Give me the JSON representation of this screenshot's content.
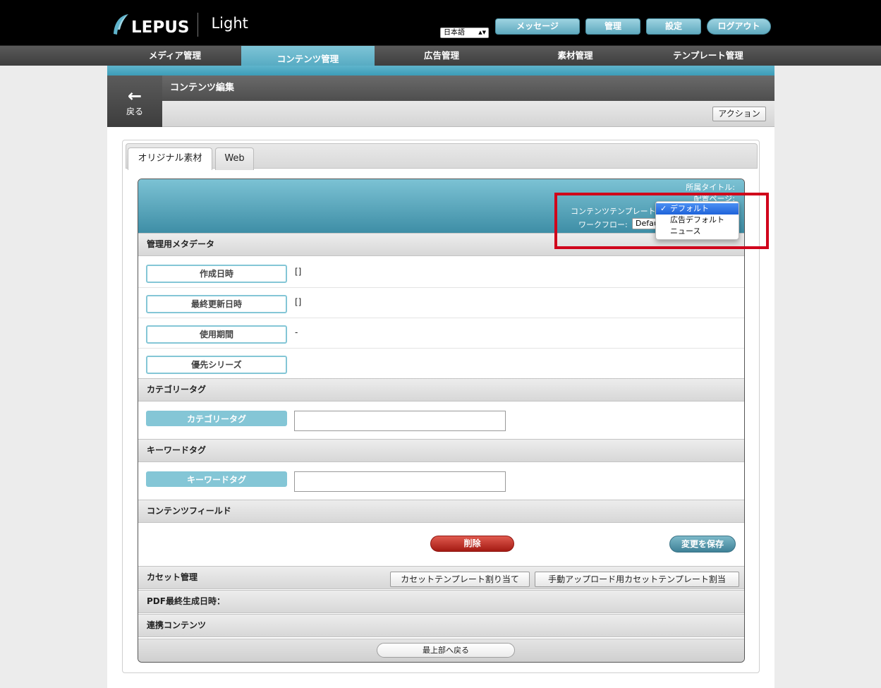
{
  "header": {
    "logo_text": "LEPUS",
    "logo_sub": "Light",
    "language": "日本語",
    "buttons": {
      "message": "メッセージ",
      "admin": "管理",
      "settings": "設定",
      "logout": "ログアウト"
    }
  },
  "nav": {
    "items": [
      "メディア管理",
      "コンテンツ管理",
      "広告管理",
      "素材管理",
      "テンプレート管理"
    ],
    "active": "コンテンツ管理"
  },
  "subheader": {
    "back_label": "戻る",
    "back_arrow": "←",
    "title": "コンテンツ編集",
    "action_label": "アクション"
  },
  "tabs": [
    "オリジナル素材",
    "Web"
  ],
  "meta_panel": {
    "owner_title_label": "所属タイトル:",
    "page_label": "配置ページ:",
    "template_label": "コンテンツテンプレート",
    "workflow_label": "ワークフロー:",
    "workflow_value": "Default"
  },
  "template_dropdown": {
    "options": [
      "デフォルト",
      "広告デフォルト",
      "ニュース"
    ],
    "selected": "デフォルト",
    "check": "✓"
  },
  "sections": {
    "admin_meta": {
      "title": "管理用メタデータ",
      "fields": [
        {
          "label": "作成日時",
          "value": "[]"
        },
        {
          "label": "最終更新日時",
          "value": "[]"
        },
        {
          "label": "使用期間",
          "value": "-"
        },
        {
          "label": "優先シリーズ",
          "value": ""
        }
      ]
    },
    "category": {
      "title": "カテゴリータグ",
      "field_label": "カテゴリータグ",
      "value": ""
    },
    "keyword": {
      "title": "キーワードタグ",
      "field_label": "キーワードタグ",
      "value": ""
    },
    "content_field": {
      "title": "コンテンツフィールド"
    },
    "cassette": {
      "title": "カセット管理",
      "assign_btn": "カセットテンプレート割り当て",
      "manual_btn": "手動アップロード用カセットテンプレート割当"
    },
    "pdf": {
      "title": "PDF最終生成日時："
    },
    "linked": {
      "title": "連携コンテンツ"
    }
  },
  "actions": {
    "delete": "削除",
    "save": "変更を保存",
    "back_to_top": "最上部へ戻る"
  },
  "colors": {
    "accent": "#5fb4cc",
    "delete": "#c0261c",
    "highlight_box": "#d0021b"
  }
}
